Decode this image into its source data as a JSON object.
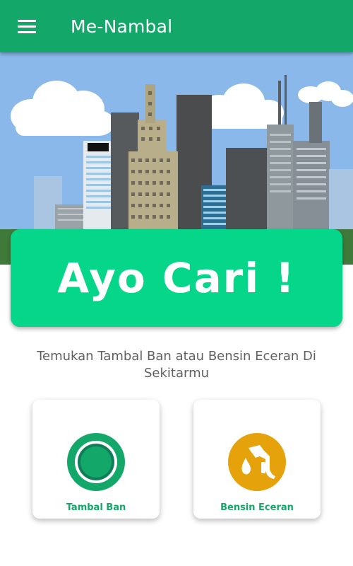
{
  "app_bar": {
    "title": "Me-Nambal",
    "menu_icon": "hamburger-menu-icon"
  },
  "hero": {
    "banner_text": "Ayo Cari !"
  },
  "main": {
    "subtitle": "Temukan Tambal Ban atau Bensin Eceran Di Sekitarmu",
    "cards": [
      {
        "label": "Tambal Ban",
        "icon": "tire-icon"
      },
      {
        "label": "Bensin Eceran",
        "icon": "fuel-nozzle-icon"
      }
    ]
  },
  "colors": {
    "primary": "#13a86a",
    "banner": "#06d68a",
    "sky": "#8ab8ea",
    "fuel_icon_bg": "#e6a20b",
    "text_gray": "#616161"
  }
}
